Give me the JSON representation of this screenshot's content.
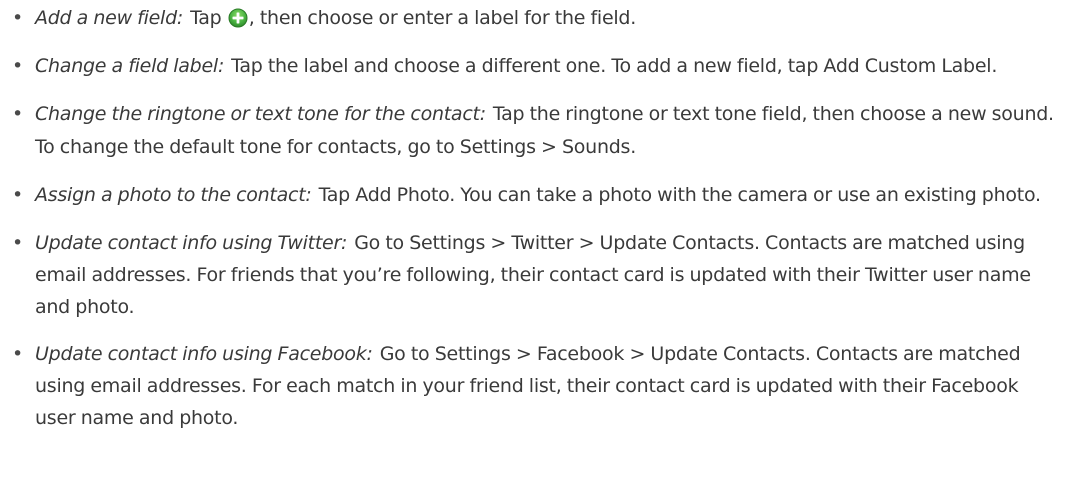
{
  "bullet_glyph": "•",
  "icon_color": "#4bb543",
  "items": [
    {
      "lead": "Add a new field:",
      "before_icon": "Tap ",
      "icon": "green-add-circle-icon",
      "after_icon": ", then choose or enter a label for the field."
    },
    {
      "lead": "Change a field label:",
      "body": "Tap the label and choose a different one. To add a new field, tap Add Custom Label."
    },
    {
      "lead": "Change the ringtone or text tone for the contact:",
      "body": "Tap the ringtone or text tone field, then choose a new sound. To change the default tone for contacts, go to Settings > Sounds."
    },
    {
      "lead": "Assign a photo to the contact:",
      "body": "Tap Add Photo. You can take a photo with the camera or use an existing photo."
    },
    {
      "lead": "Update contact info using Twitter:",
      "body": "Go to Settings > Twitter > Update Contacts. Contacts are matched using email addresses. For friends that you’re following, their contact card is updated with their Twitter user name and photo."
    },
    {
      "lead": "Update contact info using Facebook:",
      "body": "Go to Settings > Facebook > Update Contacts. Contacts are matched using email addresses. For each match in your friend list, their contact card is updated with their Facebook user name and photo."
    }
  ]
}
